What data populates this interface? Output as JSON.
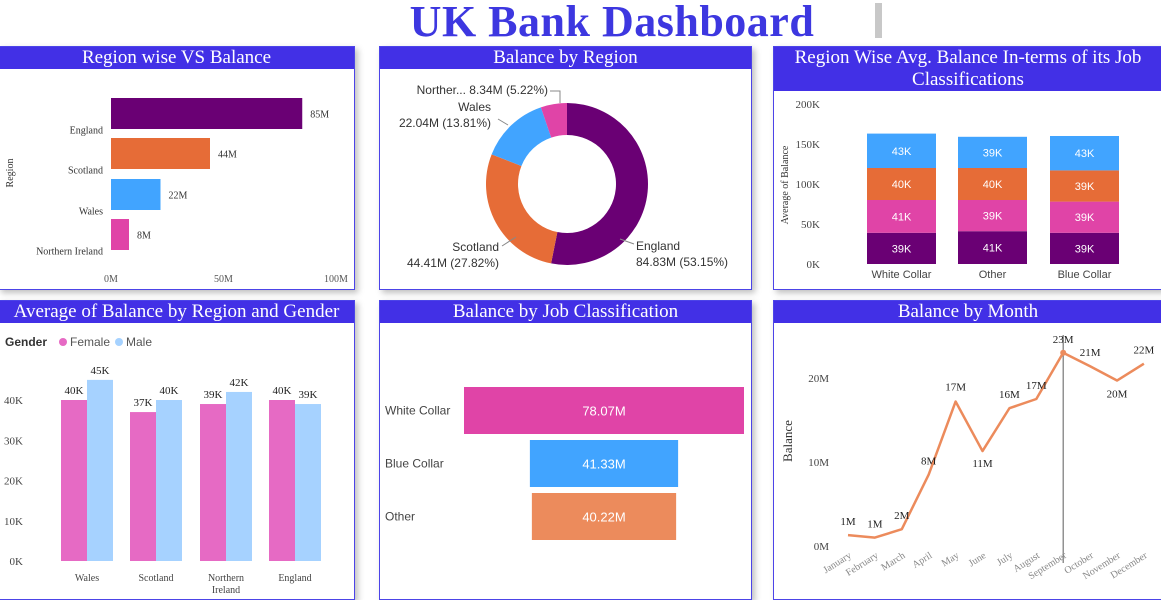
{
  "header": {
    "title": "UK Bank Dashboard"
  },
  "colors": {
    "header_blue": "#4230e6",
    "purple": "#6a0074",
    "orange": "#e66c37",
    "blue": "#41a4ff",
    "pink": "#e044a7",
    "female": "#e66ac4",
    "male": "#a6d2ff",
    "salmon": "#ec8b5c",
    "line": "#ec8b5c"
  },
  "chart_data": [
    {
      "id": "region-vs-balance",
      "type": "bar",
      "orientation": "horizontal",
      "title": "Region wise VS Balance",
      "ylabel": "Region",
      "categories": [
        "England",
        "Scotland",
        "Wales",
        "Northern Ireland"
      ],
      "values": [
        85,
        44,
        22,
        8
      ],
      "labels": [
        "85M",
        "44M",
        "22M",
        "8M"
      ],
      "xticks": [
        "0M",
        "50M",
        "100M"
      ],
      "xlim": [
        0,
        100
      ],
      "colors": [
        "#6a0074",
        "#e66c37",
        "#41a4ff",
        "#e044a7"
      ]
    },
    {
      "id": "balance-by-region",
      "type": "pie",
      "donut": true,
      "title": "Balance by Region",
      "slices": [
        {
          "name": "England",
          "value": 84.83,
          "label": "84.83M (53.15%)",
          "color": "#6a0074"
        },
        {
          "name": "Scotland",
          "value": 44.41,
          "label": "44.41M (27.82%)",
          "color": "#e66c37"
        },
        {
          "name": "Wales",
          "value": 22.04,
          "label": "22.04M (13.81%)",
          "color": "#41a4ff"
        },
        {
          "name": "Norther...",
          "value": 8.34,
          "label": "8.34M (5.22%)",
          "color": "#e044a7"
        }
      ]
    },
    {
      "id": "region-avg-balance-job",
      "type": "bar",
      "stacked": true,
      "title": "Region Wise Avg. Balance In-terms of its Job Classifications",
      "ylabel": "Average of Balance",
      "categories": [
        "White Collar",
        "Other",
        "Blue Collar"
      ],
      "yticks": [
        "0K",
        "50K",
        "100K",
        "150K",
        "200K"
      ],
      "ylim": [
        0,
        200
      ],
      "series": [
        {
          "color": "#6a0074",
          "values": [
            39,
            41,
            39
          ],
          "labels": [
            "39K",
            "41K",
            "39K"
          ]
        },
        {
          "color": "#e044a7",
          "values": [
            41,
            39,
            39
          ],
          "labels": [
            "41K",
            "39K",
            "39K"
          ]
        },
        {
          "color": "#e66c37",
          "values": [
            40,
            40,
            39
          ],
          "labels": [
            "40K",
            "40K",
            "39K"
          ]
        },
        {
          "color": "#41a4ff",
          "values": [
            43,
            39,
            43
          ],
          "labels": [
            "43K",
            "39K",
            "43K"
          ]
        }
      ]
    },
    {
      "id": "avg-balance-region-gender",
      "type": "bar",
      "title": "Average of Balance by Region and Gender",
      "legend_title": "Gender",
      "legend_position": "top-left",
      "categories": [
        "Wales",
        "Scotland",
        "Northern Ireland",
        "England"
      ],
      "yticks": [
        "0K",
        "10K",
        "20K",
        "30K",
        "40K"
      ],
      "ylim": [
        0,
        47
      ],
      "series": [
        {
          "name": "Female",
          "color": "#e66ac4",
          "values": [
            40,
            37,
            39,
            40
          ],
          "labels": [
            "40K",
            "37K",
            "39K",
            "40K"
          ]
        },
        {
          "name": "Male",
          "color": "#a6d2ff",
          "values": [
            45,
            40,
            42,
            39
          ],
          "labels": [
            "45K",
            "40K",
            "42K",
            "39K"
          ]
        }
      ]
    },
    {
      "id": "balance-by-job",
      "type": "bar",
      "orientation": "horizontal",
      "funnel": true,
      "title": "Balance by Job Classification",
      "categories": [
        "White Collar",
        "Blue Collar",
        "Other"
      ],
      "values": [
        78.07,
        41.33,
        40.22
      ],
      "labels": [
        "78.07M",
        "41.33M",
        "40.22M"
      ],
      "colors": [
        "#e044a7",
        "#41a4ff",
        "#ec8b5c"
      ]
    },
    {
      "id": "balance-by-month",
      "type": "line",
      "title": "Balance by Month",
      "ylabel": "Balance",
      "x": [
        "January",
        "February",
        "March",
        "April",
        "May",
        "June",
        "July",
        "August",
        "September",
        "October",
        "November",
        "December"
      ],
      "y": [
        1.3,
        1.0,
        2.0,
        8.5,
        17.2,
        11.3,
        16.4,
        17.5,
        23.0,
        21.4,
        19.7,
        21.7
      ],
      "labels": [
        "1M",
        "1M",
        "2M",
        "8M",
        "17M",
        "11M",
        "16M",
        "17M",
        "23M",
        "21M",
        "20M",
        "22M"
      ],
      "yticks": [
        "0M",
        "10M",
        "20M"
      ],
      "ylim": [
        0,
        25
      ],
      "color": "#ec8b5c"
    }
  ]
}
